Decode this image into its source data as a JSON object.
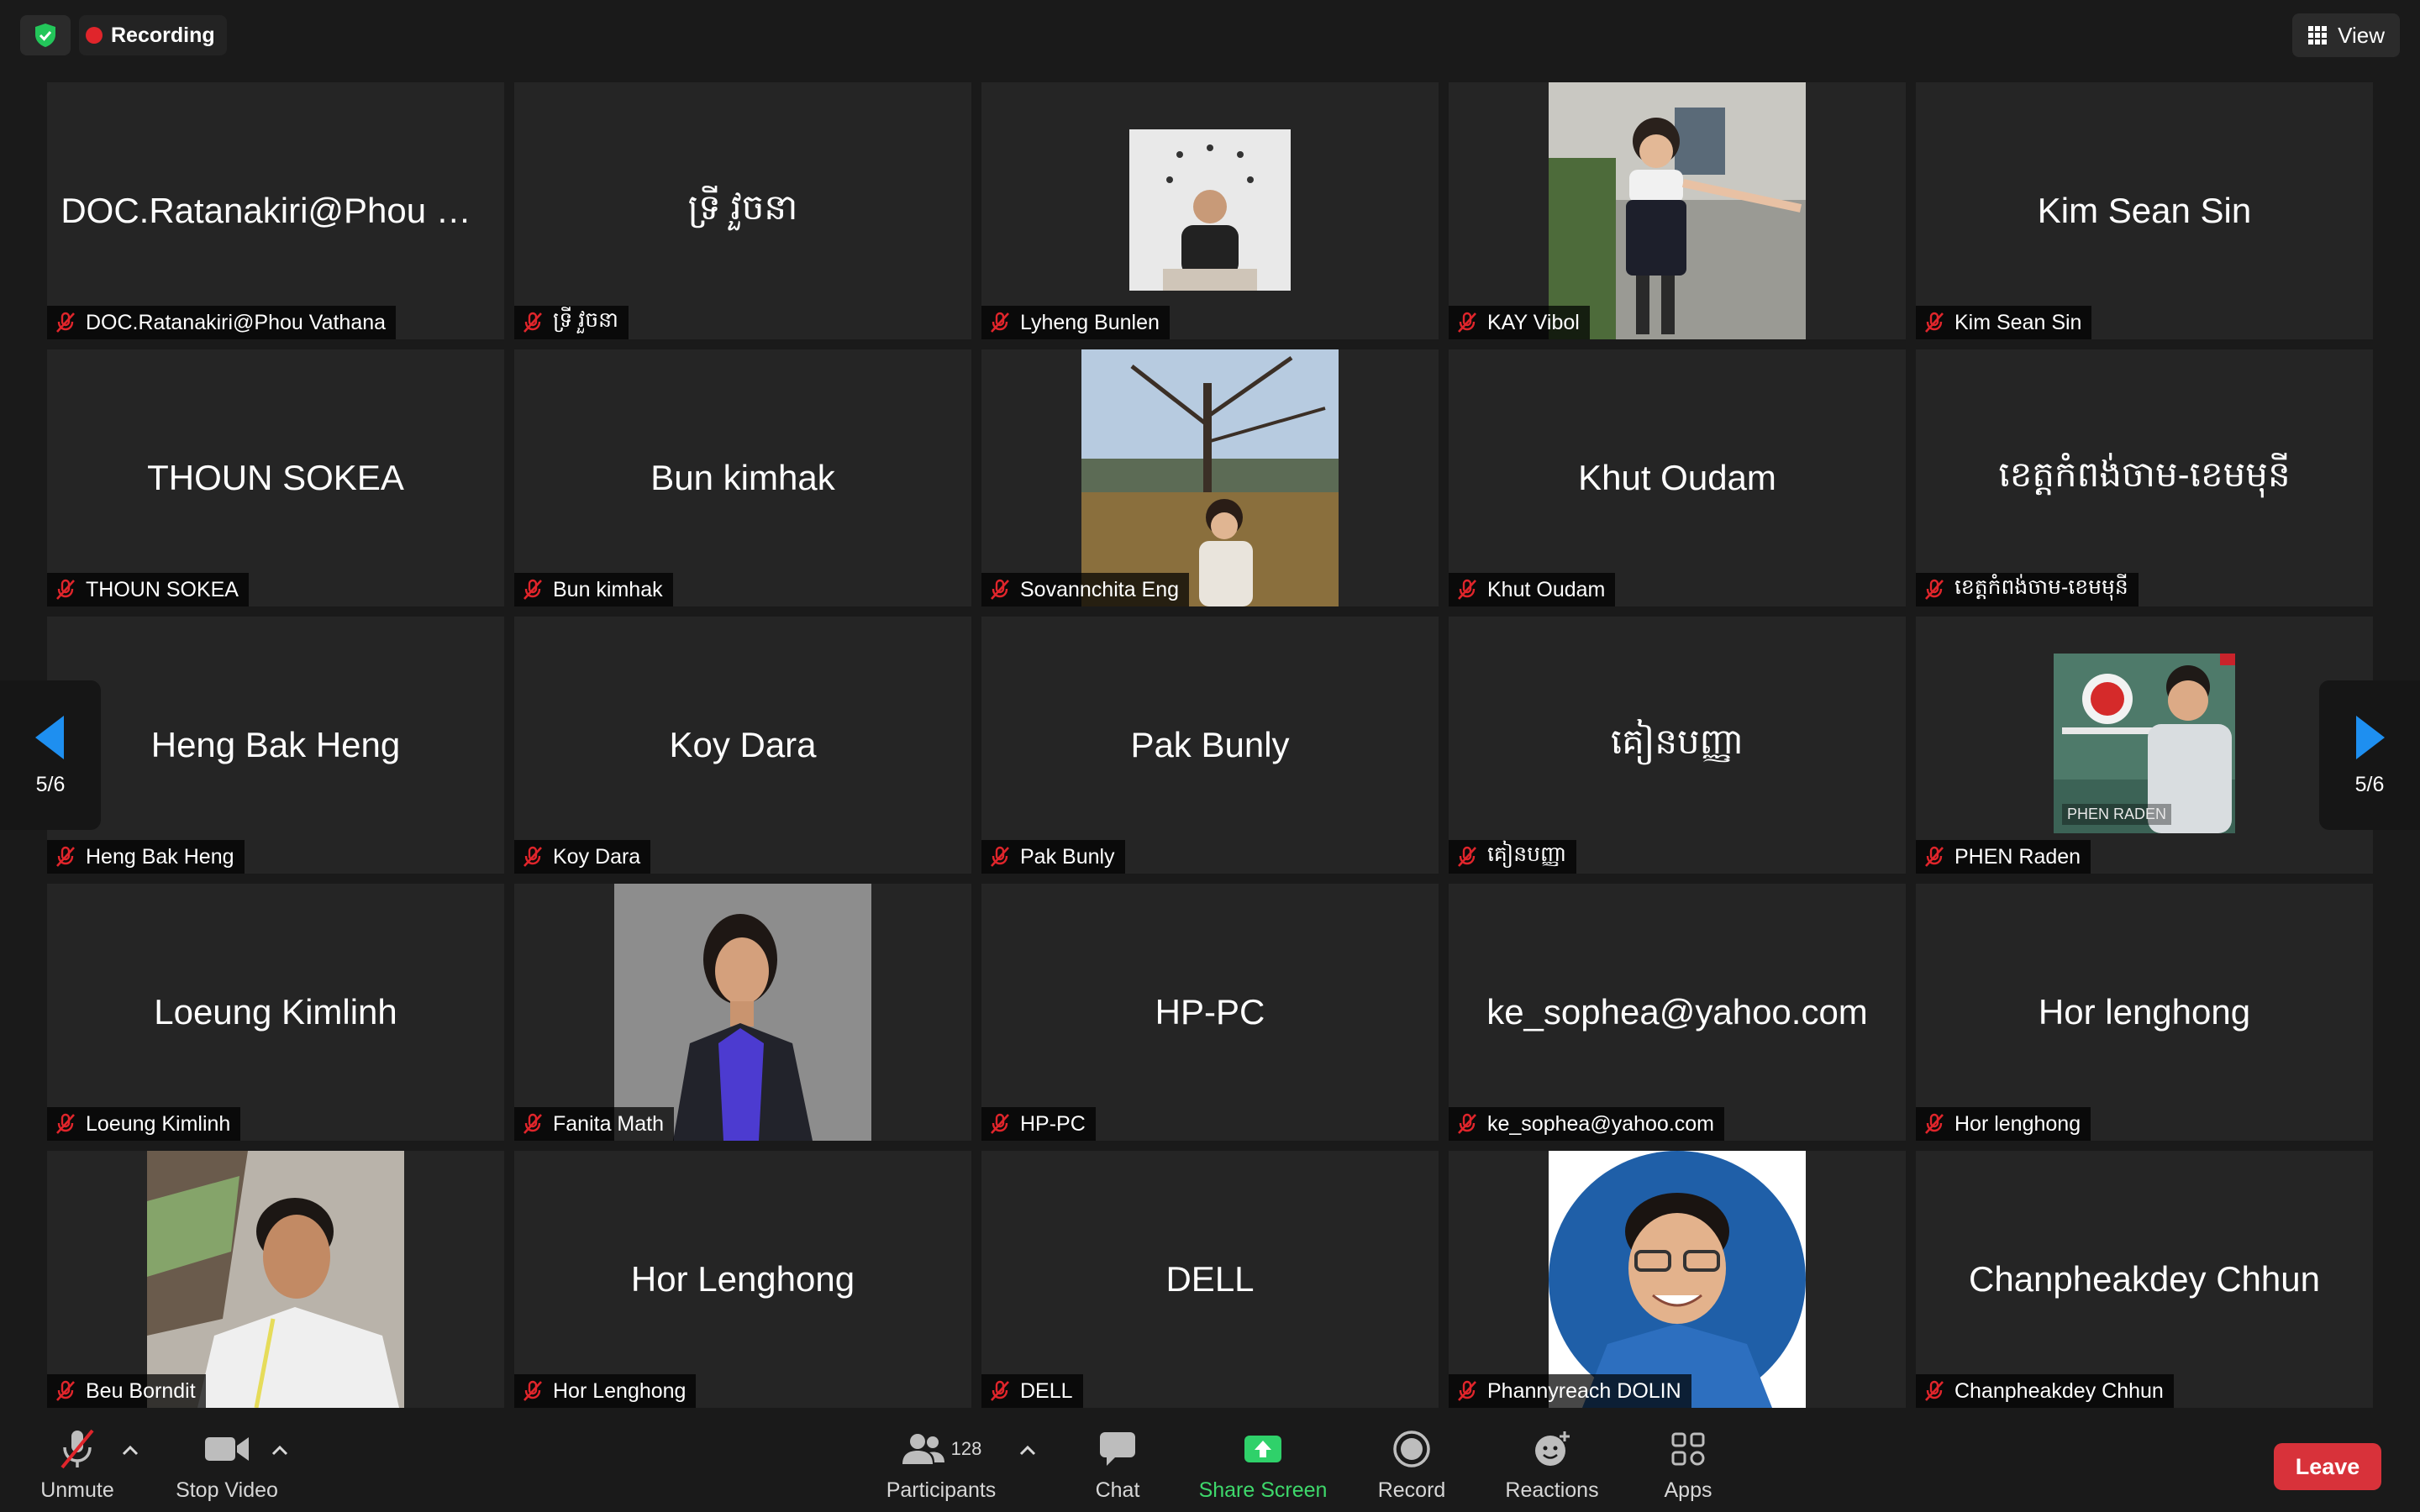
{
  "topbar": {
    "recording_label": "Recording",
    "view_label": "View"
  },
  "pager": {
    "left_label": "5/6",
    "right_label": "5/6"
  },
  "tiles": [
    {
      "display": "DOC.Ratanakiri@Phou Vat...",
      "label": "DOC.Ratanakiri@Phou Vathana",
      "photo": false
    },
    {
      "display": "ទ្រី វួចនា",
      "label": "ទ្រី វួចនា",
      "photo": false
    },
    {
      "display": "",
      "label": "Lyheng Bunlen",
      "photo": true
    },
    {
      "display": "",
      "label": "KAY Vibol",
      "photo": true
    },
    {
      "display": "Kim Sean Sin",
      "label": "Kim Sean Sin",
      "photo": false
    },
    {
      "display": "THOUN SOKEA",
      "label": "THOUN SOKEA",
      "photo": false
    },
    {
      "display": "Bun kimhak",
      "label": "Bun kimhak",
      "photo": false
    },
    {
      "display": "",
      "label": "Sovannchita Eng",
      "photo": true
    },
    {
      "display": "Khut Oudam",
      "label": "Khut Oudam",
      "photo": false
    },
    {
      "display": "ខេត្តកំពង់ចាម-ខេមមុនី",
      "label": "ខេត្តកំពង់ចាម-ខេមមុនី",
      "photo": false
    },
    {
      "display": "Heng Bak Heng",
      "label": "Heng Bak Heng",
      "photo": false
    },
    {
      "display": "Koy Dara",
      "label": "Koy Dara",
      "photo": false
    },
    {
      "display": "Pak Bunly",
      "label": "Pak Bunly",
      "photo": false
    },
    {
      "display": "គៀនបញ្ញា",
      "label": "គៀនបញ្ញា",
      "photo": false
    },
    {
      "display": "",
      "label": "PHEN Raden",
      "photo": true
    },
    {
      "display": "Loeung Kimlinh",
      "label": "Loeung Kimlinh",
      "photo": false
    },
    {
      "display": "",
      "label": "Fanita Math",
      "photo": true
    },
    {
      "display": "HP-PC",
      "label": "HP-PC",
      "photo": false
    },
    {
      "display": "ke_sophea@yahoo.com",
      "label": "ke_sophea@yahoo.com",
      "photo": false
    },
    {
      "display": "Hor lenghong",
      "label": "Hor lenghong",
      "photo": false
    },
    {
      "display": "",
      "label": "Beu Borndit",
      "photo": true
    },
    {
      "display": "Hor Lenghong",
      "label": "Hor Lenghong",
      "photo": false
    },
    {
      "display": "DELL",
      "label": "DELL",
      "photo": false
    },
    {
      "display": "",
      "label": "Phannyreach DOLIN",
      "photo": true
    },
    {
      "display": "Chanpheakdey Chhun",
      "label": "Chanpheakdey Chhun",
      "photo": false
    }
  ],
  "phen_overlay_label": "PHEN RADEN",
  "toolbar": {
    "unmute_label": "Unmute",
    "stop_video_label": "Stop Video",
    "participants_label": "Participants",
    "participants_count": "128",
    "chat_label": "Chat",
    "share_label": "Share Screen",
    "record_label": "Record",
    "reactions_label": "Reactions",
    "apps_label": "Apps",
    "leave_label": "Leave"
  },
  "colors": {
    "background": "#1a1a1a",
    "tile": "#252525",
    "recording": "#e0252b",
    "share_green": "#3ed86b",
    "leave_red": "#d8323a",
    "nav_arrow": "#1e8ff0"
  }
}
